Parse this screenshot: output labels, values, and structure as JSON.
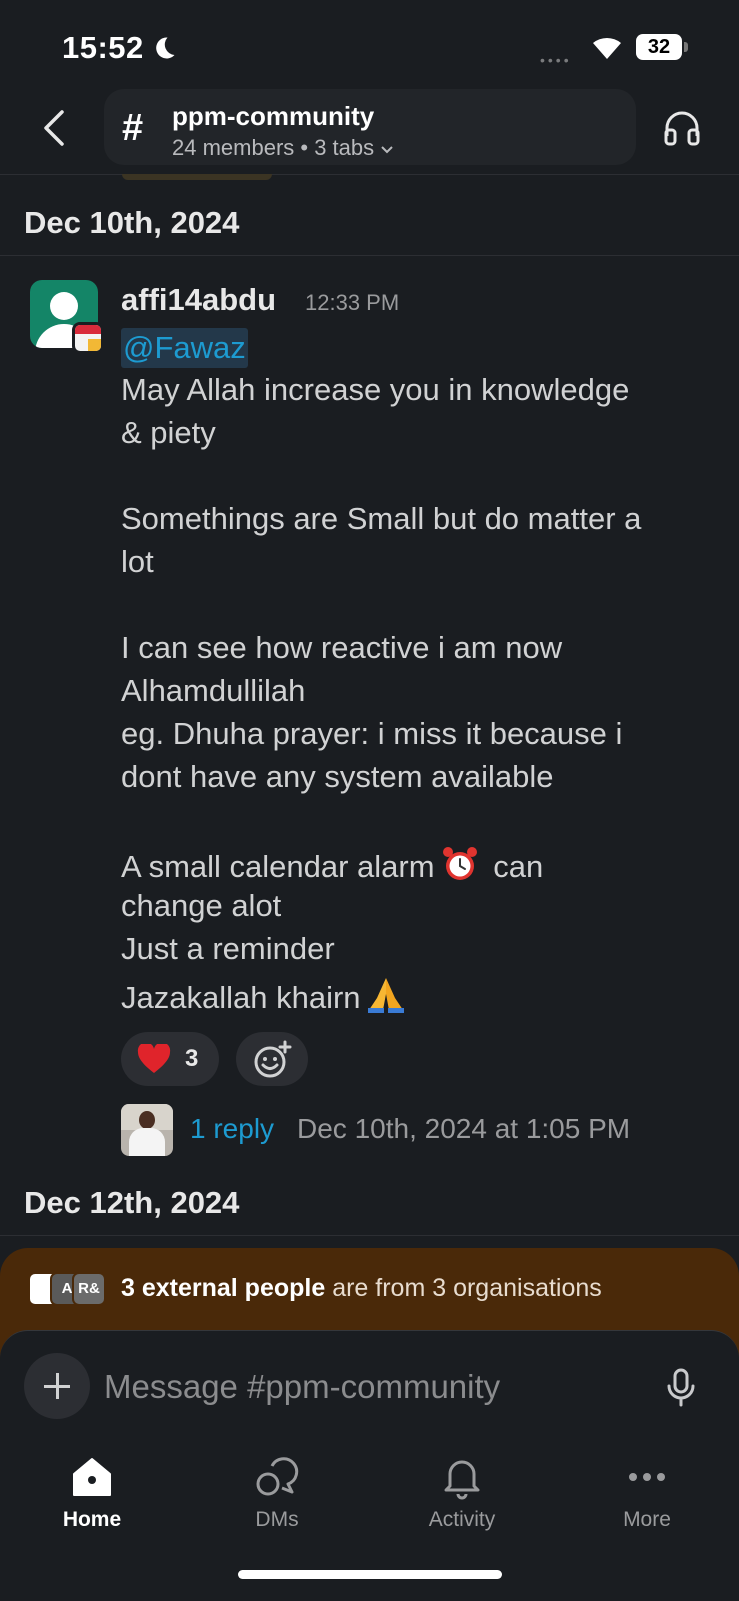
{
  "status_bar": {
    "time": "15:52",
    "battery": "32"
  },
  "header": {
    "channel_name": "ppm-community",
    "meta": "24 members • 3 tabs",
    "hash": "#"
  },
  "date_separators": [
    "Dec 10th, 2024",
    "Dec 12th, 2024"
  ],
  "message": {
    "author": "affi14abdu",
    "time": "12:33 PM",
    "mention": "@Fawaz",
    "lines": [
      "May Allah increase you in knowledge",
      "& piety",
      "Somethings are Small but do matter a",
      "lot",
      "I can see how reactive i am now",
      "Alhamdullilah",
      "eg. Dhuha prayer: i miss it because i",
      "dont have any system available",
      "A small calendar alarm",
      "can",
      "change alot",
      "Just a reminder",
      "Jazakallah khairn"
    ],
    "reaction": {
      "emoji": "heart",
      "count": "3"
    },
    "thread": {
      "replies": "1 reply",
      "last_reply": "Dec 10th, 2024 at 1:05 PM"
    }
  },
  "external_banner": {
    "highlight": "3 external people",
    "rest": " are from 3 organisations",
    "badges": [
      "",
      "A",
      "R&"
    ]
  },
  "composer": {
    "placeholder": "Message #ppm-community"
  },
  "tabs": [
    {
      "label": "Home"
    },
    {
      "label": "DMs"
    },
    {
      "label": "Activity"
    },
    {
      "label": "More"
    }
  ]
}
